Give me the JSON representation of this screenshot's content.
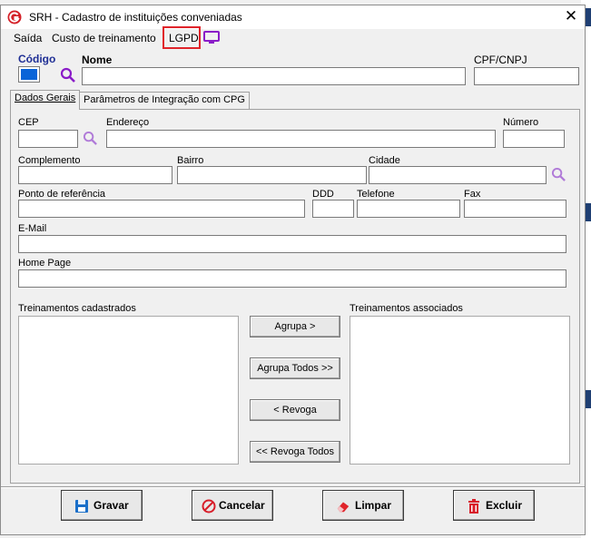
{
  "window": {
    "title": "SRH - Cadastro de instituições conveniadas"
  },
  "menu": {
    "items": [
      "Saída",
      "Custo de treinamento",
      "LGPD"
    ]
  },
  "header": {
    "code_label": "Código",
    "name_label": "Nome",
    "cpf_label": "CPF/CNPJ"
  },
  "tabs": [
    "Dados Gerais",
    "Parâmetros de Integração com CPG"
  ],
  "form": {
    "cep": "CEP",
    "endereco": "Endereço",
    "numero": "Número",
    "complemento": "Complemento",
    "bairro": "Bairro",
    "cidade": "Cidade",
    "ponto_referencia": "Ponto de referência",
    "ddd": "DDD",
    "telefone": "Telefone",
    "fax": "Fax",
    "email": "E-Mail",
    "home_page": "Home Page"
  },
  "lists": {
    "cadastrados": "Treinamentos cadastrados",
    "associados": "Treinamentos associados"
  },
  "transfer_buttons": {
    "agrupa": "Agrupa >",
    "agrupa_todos": "Agrupa Todos >>",
    "revoga": "< Revoga",
    "revoga_todos": "<< Revoga Todos"
  },
  "actions": {
    "gravar": "Gravar",
    "cancelar": "Cancelar",
    "limpar": "Limpar",
    "excluir": "Excluir"
  },
  "colors": {
    "accent_purple": "#8a1cc8",
    "lgpd_border": "#e0242a",
    "code_label": "#1f2f95",
    "selection": "#0a64d8"
  },
  "icons": {
    "app": "srh-logo-icon",
    "close": "close-icon",
    "monitor": "monitor-icon",
    "search": "search-icon",
    "save": "floppy-disk-icon",
    "cancel": "no-entry-icon",
    "clear": "eraser-icon",
    "delete": "trash-icon"
  }
}
